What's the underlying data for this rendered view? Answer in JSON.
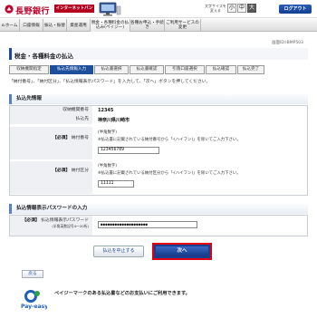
{
  "header": {
    "bank_name": "長野銀行",
    "ib_banner": "インターネットバンキング",
    "text_size_label": "文字サイズを変える",
    "size_small": "小",
    "size_mid": "中",
    "size_large": "大",
    "logout": "ログアウト"
  },
  "nav": {
    "items": [
      "ホーム",
      "口座情報",
      "振込・振替",
      "資産運用",
      "税金・各種料金の払込み(ペイジー)",
      "各種お申込・手続き",
      "ご利用サービスの変更"
    ]
  },
  "screen_id": "画面ID:IBMP503",
  "page_title": "税金・各種料金の払込",
  "steps": [
    "収納機関指定",
    "払込先情報入力",
    "払込書選択",
    "払込書確認",
    "引落口座選択",
    "払込確認",
    "払込完了"
  ],
  "current_step": 1,
  "instruction": "「納付番号」、「納付区分」、「払込情報表示パスワード」を入力して、「次へ」ボタンを押してください。",
  "payee_section": {
    "title": "払込先情報",
    "agency_number_label": "収納機関番号",
    "agency_number": "12345",
    "payee_label": "払込先",
    "payee_name": "神奈川県川崎市",
    "required_tag": "【必須】",
    "payment_number_label": "納付番号",
    "payment_number_note1": "(半角数字)",
    "payment_number_note2": "※払込書に記載されている納付番号から「-(ハイフン)」を除いてご入力下さい。",
    "payment_number_value": "123456789",
    "payment_class_label": "納付区分",
    "payment_class_note1": "(半角数字)",
    "payment_class_note2": "※払込書に記載されている納付区分から「-(ハイフン)」を除いてご入力下さい。",
    "payment_class_value": "11111"
  },
  "password_section": {
    "title": "払込情報表示パスワードの入力",
    "required_tag": "【必須】",
    "label": "払込情報表示パスワード",
    "sublabel": "(半角英数記号4～20桁)",
    "value": "●●●●●●●●●●●●●●●●●●●●"
  },
  "buttons": {
    "cancel": "払込を中止する",
    "next": "次へ",
    "back": "戻る"
  },
  "footer": {
    "payeasy_logo_text": "Pay-easy",
    "payeasy_note": "ペイジーマークのある払込書などのお支払いにご利用できます。"
  },
  "colors": {
    "brand_red": "#c0002a",
    "nav_blue": "#1d4f9c",
    "highlight_red": "#e00012"
  }
}
